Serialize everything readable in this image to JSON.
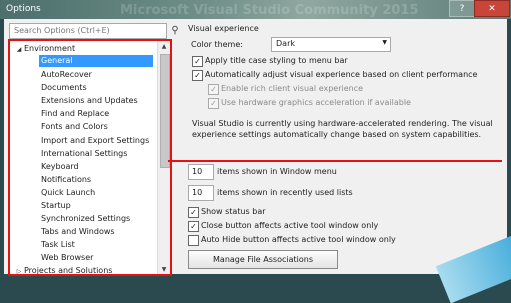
{
  "window": {
    "title": "Options",
    "watermark": "Microsoft Visual Studio Community 2015",
    "help_label": "?",
    "close_label": "✕"
  },
  "search": {
    "placeholder": "Search Options (Ctrl+E)",
    "icon": "search-icon"
  },
  "tree": {
    "items": [
      {
        "label": "Environment",
        "expander": "◢"
      },
      {
        "label": "General"
      },
      {
        "label": "AutoRecover"
      },
      {
        "label": "Documents"
      },
      {
        "label": "Extensions and Updates"
      },
      {
        "label": "Find and Replace"
      },
      {
        "label": "Fonts and Colors"
      },
      {
        "label": "Import and Export Settings"
      },
      {
        "label": "International Settings"
      },
      {
        "label": "Keyboard"
      },
      {
        "label": "Notifications"
      },
      {
        "label": "Quick Launch"
      },
      {
        "label": "Startup"
      },
      {
        "label": "Synchronized Settings"
      },
      {
        "label": "Tabs and Windows"
      },
      {
        "label": "Task List"
      },
      {
        "label": "Web Browser"
      },
      {
        "label": "Projects and Solutions",
        "expander": "▷"
      }
    ],
    "selected_index": 1,
    "scroll_up": "▲",
    "scroll_down": "▼"
  },
  "visual": {
    "heading": "Visual experience",
    "color_theme_label": "Color theme:",
    "color_theme_value": "Dark",
    "dropdown_arrow": "▼",
    "options": [
      {
        "label": "Apply title case styling to menu bar",
        "checked": true,
        "enabled": true
      },
      {
        "label": "Automatically adjust visual experience based on client performance",
        "checked": true,
        "enabled": true
      },
      {
        "label": "Enable rich client visual experience",
        "checked": true,
        "enabled": false
      },
      {
        "label": "Use hardware graphics acceleration if available",
        "checked": true,
        "enabled": false
      }
    ],
    "info_line1": "Visual Studio is currently using hardware-accelerated rendering. The visual",
    "info_line2": "experience settings automatically change based on system capabilities."
  },
  "window_menu": {
    "value": "10",
    "label": "items shown in Window menu"
  },
  "recent_lists": {
    "value": "10",
    "label": "items shown in recently used lists"
  },
  "general_options": [
    {
      "label": "Show status bar",
      "checked": true
    },
    {
      "label": "Close button affects active tool window only",
      "checked": true
    },
    {
      "label": "Auto Hide button affects active tool window only",
      "checked": false
    }
  ],
  "check_mark": "✓",
  "manage_button": "Manage File Associations",
  "colors": {
    "selection": "#3399ff",
    "annotation": "#e81010",
    "title_bar": "#5e7e79"
  }
}
